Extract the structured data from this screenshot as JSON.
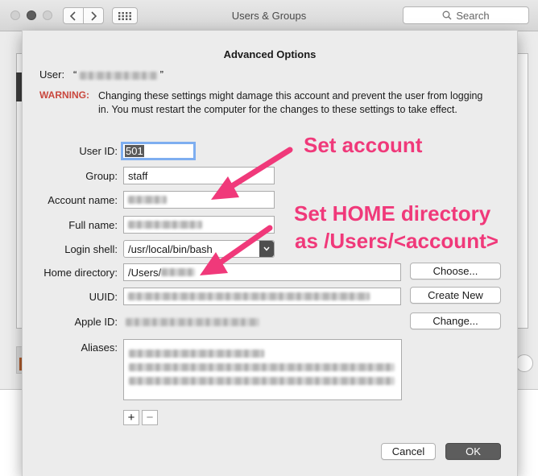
{
  "window": {
    "title": "Users & Groups"
  },
  "search": {
    "placeholder": "Search"
  },
  "sheet": {
    "title": "Advanced Options",
    "user_label": "User:",
    "user_open_quote": "“",
    "user_close_quote": "”",
    "warning_label": "WARNING:",
    "warning_text": "Changing these settings might damage this account and prevent the user from logging in. You must restart the computer for the changes to these settings to take effect.",
    "fields": {
      "user_id": {
        "label": "User ID:",
        "value": "501"
      },
      "group": {
        "label": "Group:",
        "value": "staff"
      },
      "account_name": {
        "label": "Account name:"
      },
      "full_name": {
        "label": "Full name:"
      },
      "login_shell": {
        "label": "Login shell:",
        "value": "/usr/local/bin/bash"
      },
      "home_directory": {
        "label": "Home directory:",
        "value": "/Users/"
      },
      "uuid": {
        "label": "UUID:"
      },
      "apple_id": {
        "label": "Apple ID:"
      },
      "aliases": {
        "label": "Aliases:"
      }
    },
    "buttons": {
      "choose": "Choose...",
      "create_new": "Create New",
      "change": "Change...",
      "add": "+",
      "remove": "−",
      "cancel": "Cancel",
      "ok": "OK"
    }
  },
  "annotations": {
    "set_account": "Set account",
    "set_home_line1": "Set HOME directory",
    "set_home_line2": "as /Users/<account>"
  },
  "colors": {
    "annotation": "#f0397a",
    "warning": "#c9473d",
    "focus_ring": "#7eaef0"
  }
}
